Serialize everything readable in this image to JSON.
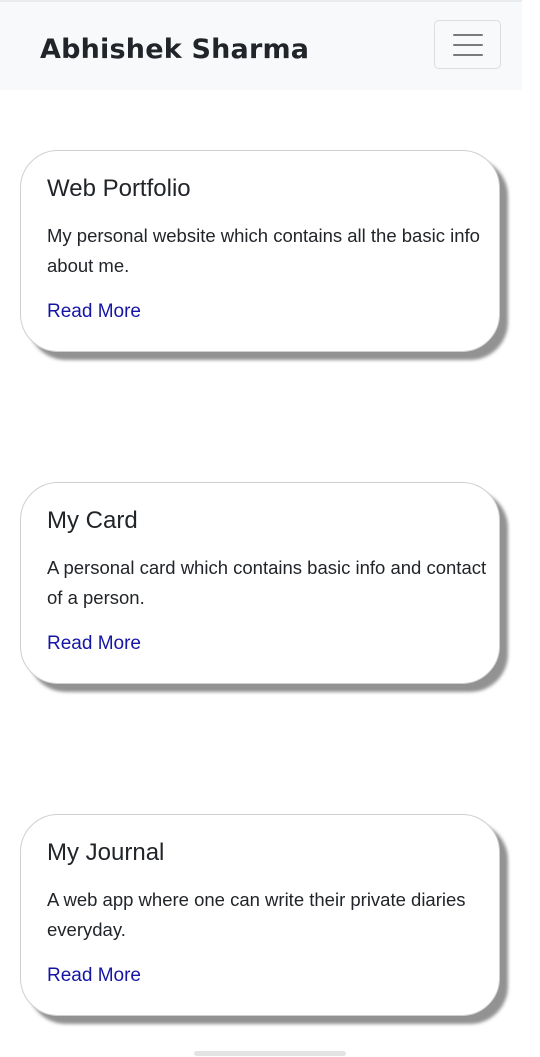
{
  "navbar": {
    "brand": "Abhishek Sharma",
    "toggler_icon": "hamburger-menu-icon"
  },
  "cards": [
    {
      "title": "Web Portfolio",
      "text": "My personal website which contains all the basic info about me.",
      "link": "Read More"
    },
    {
      "title": "My Card",
      "text": "A personal card which contains basic info and contact of a person.",
      "link": "Read More"
    },
    {
      "title": "My Journal",
      "text": "A web app where one can write their private diaries everyday.",
      "link": "Read More"
    }
  ],
  "colors": {
    "navbar_bg": "#f8f9fa",
    "link": "#1515a6",
    "text": "#212529"
  }
}
